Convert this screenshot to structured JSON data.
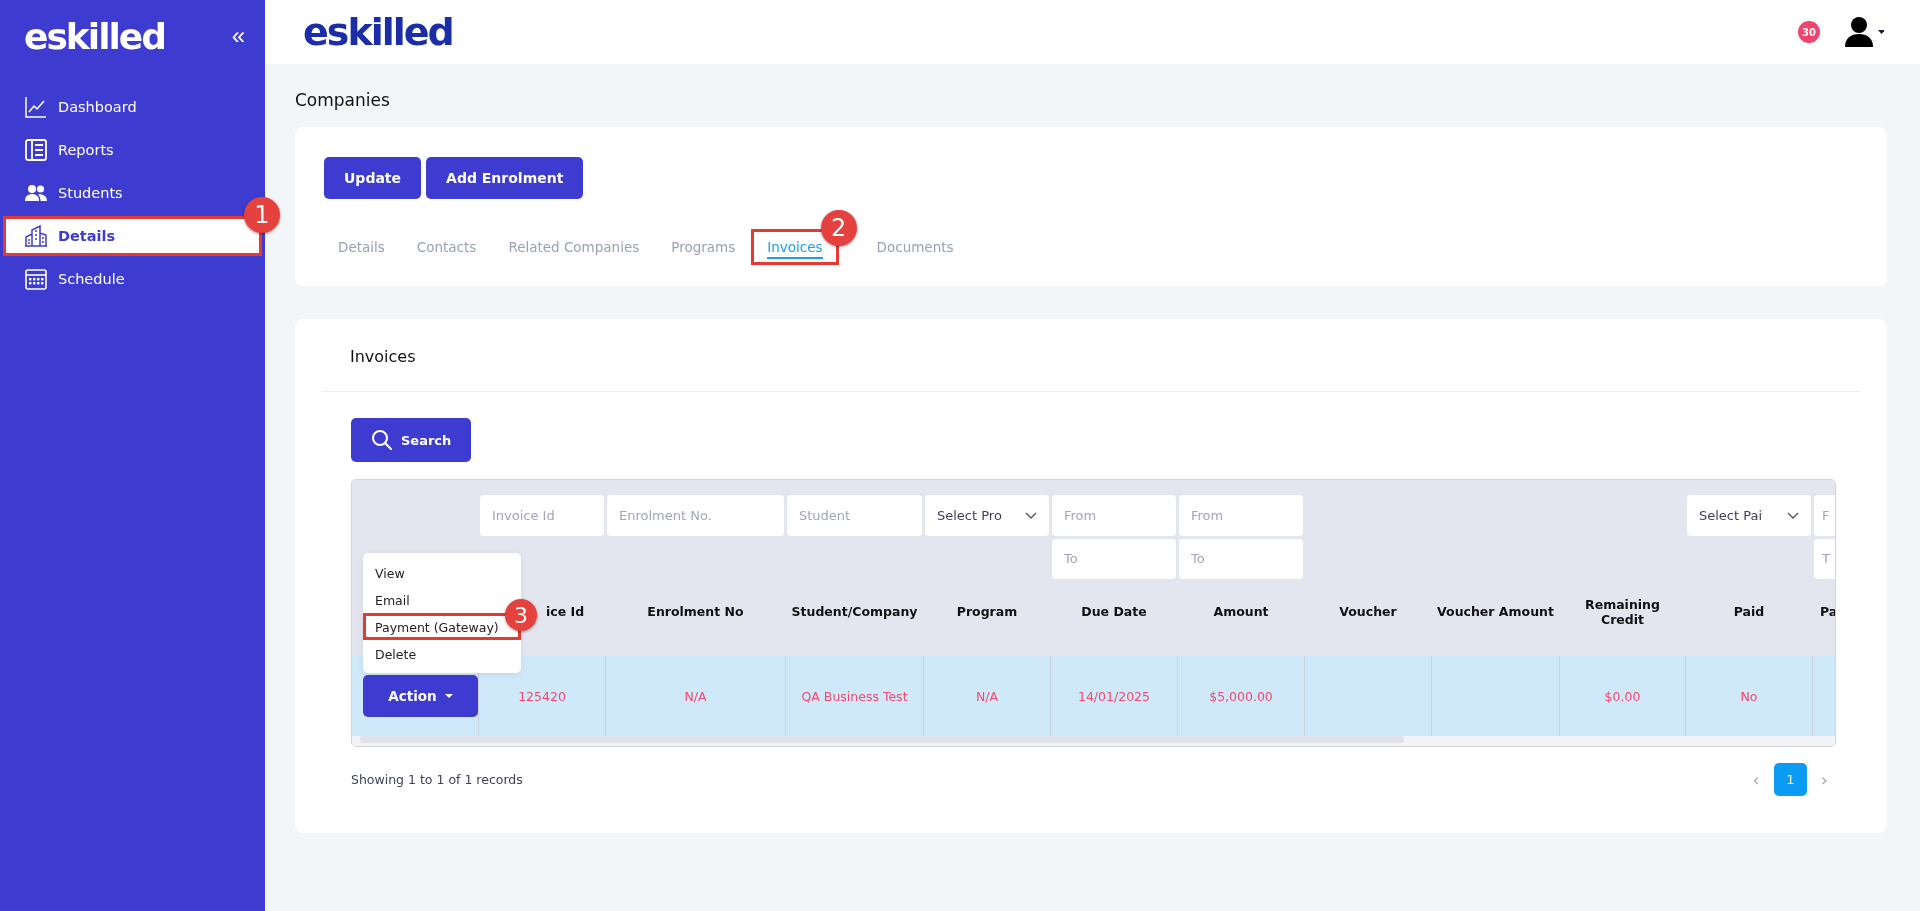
{
  "sidebar": {
    "logo": "eskilled",
    "collapse": "«",
    "items": [
      {
        "label": "Dashboard",
        "selected": false
      },
      {
        "label": "Reports",
        "selected": false
      },
      {
        "label": "Students",
        "selected": false
      },
      {
        "label": "Details",
        "selected": true,
        "callout": "1"
      },
      {
        "label": "Schedule",
        "selected": false
      }
    ]
  },
  "header": {
    "logo": "eskilled",
    "notification_count": "30"
  },
  "page_title": "Companies",
  "actions": [
    "Update",
    "Add Enrolment"
  ],
  "tabs": [
    {
      "label": "Details",
      "selected": false
    },
    {
      "label": "Contacts",
      "selected": false
    },
    {
      "label": "Related Companies",
      "selected": false
    },
    {
      "label": "Programs",
      "selected": false
    },
    {
      "label": "Invoices",
      "selected": true,
      "callout": "2"
    },
    {
      "label": "Documents",
      "selected": false
    }
  ],
  "invoices": {
    "title": "Invoices",
    "search_button": "Search",
    "filters": [
      {
        "kind": "text",
        "placeholder": "Invoice Id"
      },
      {
        "kind": "text",
        "placeholder": "Enrolment No."
      },
      {
        "kind": "text",
        "placeholder": "Student"
      },
      {
        "kind": "select",
        "value": "Select Pro"
      },
      {
        "kind": "range",
        "fields": [
          {
            "placeholder": "From"
          },
          {
            "placeholder": "To"
          }
        ]
      },
      {
        "kind": "range",
        "fields": [
          {
            "placeholder": "From"
          },
          {
            "placeholder": "To"
          }
        ]
      },
      {
        "kind": "none"
      },
      {
        "kind": "none"
      },
      {
        "kind": "none"
      },
      {
        "kind": "select",
        "value": "Select Pai"
      },
      {
        "kind": "range",
        "fields": [
          {
            "placeholder": "F"
          },
          {
            "placeholder": "T"
          }
        ]
      }
    ],
    "columns": [
      "ice Id",
      "Enrolment No",
      "Student/Company",
      "Program",
      "Due Date",
      "Amount",
      "Voucher",
      "Voucher Amount",
      "Remaining Credit",
      "Paid",
      "Pa"
    ],
    "rows": [
      {
        "action": "Action",
        "cells": [
          "125420",
          "N/A",
          "QA Business Test",
          "N/A",
          "14/01/2025",
          "$5,000.00",
          null,
          null,
          "$0.00",
          "No",
          null
        ]
      }
    ],
    "action_menu": [
      {
        "label": "View"
      },
      {
        "label": "Email"
      },
      {
        "label": "Payment (Gateway)",
        "callout": "3"
      },
      {
        "label": "Delete"
      }
    ],
    "footer": "Showing 1 to 1 of 1 records",
    "pagination": {
      "prev": "‹",
      "next": "›",
      "pages": [
        {
          "label": "1",
          "selected": true
        }
      ]
    }
  }
}
